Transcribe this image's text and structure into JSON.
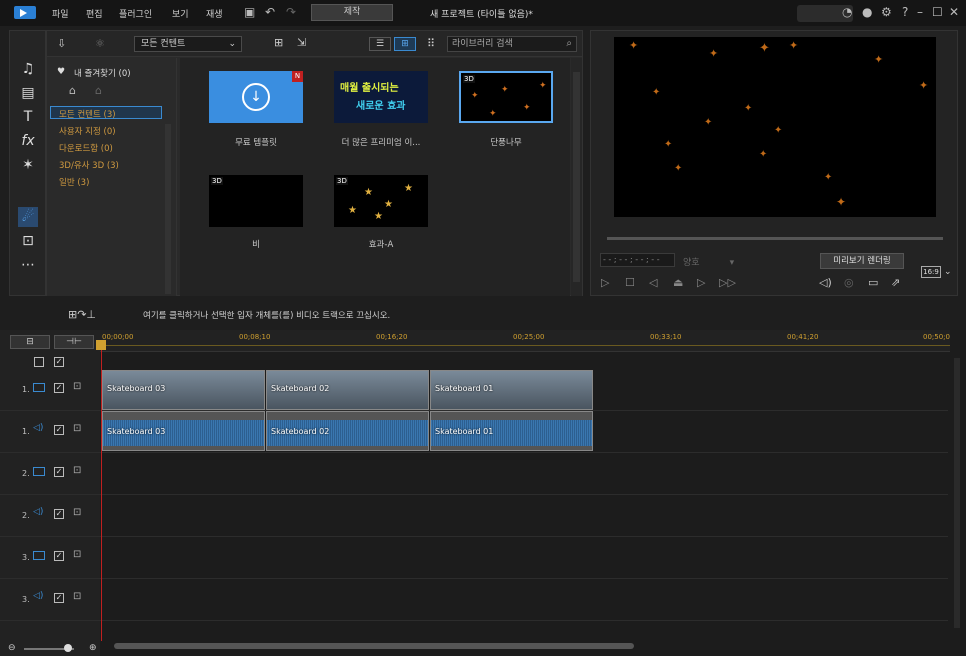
{
  "menu": {
    "file": "파일",
    "edit": "편집",
    "plugin": "플러그인",
    "view": "보기",
    "play": "재생",
    "produce": "제작",
    "title": "새 프로젝트 (타이틀 없음)*"
  },
  "library": {
    "content_filter": "모든 컨텐트",
    "search_placeholder": "라이브러리 검색",
    "tree": {
      "favorites": "내 즐겨찾기 (0)",
      "items": [
        "모든 컨텐트 (3)",
        "사용자 지정 (0)",
        "다운로드함 (0)",
        "3D/유사 3D (3)",
        "일반 (3)"
      ]
    },
    "thumbs": [
      {
        "label": "무료 템플릿",
        "tag": "N"
      },
      {
        "label": "더 많은 프리미엄 이...",
        "banner1": "매월 출시되는",
        "banner2": "새로운 효과"
      },
      {
        "label": "단풍나무",
        "tag": "3D"
      },
      {
        "label": "비",
        "tag": "3D"
      },
      {
        "label": "효과-A",
        "tag": "3D"
      }
    ]
  },
  "preview": {
    "timecode": "- - ; - - ; - - ; - -",
    "quality": "양호",
    "render_button": "미리보기 렌더링",
    "ratio": "16:9"
  },
  "timeline": {
    "hint": "여기를 클릭하거나 선택한 입자 개체를(를) 비디오 트랙으로 끄십시오.",
    "ticks": [
      "00;00;00",
      "00;08;10",
      "00;16;20",
      "00;25;00",
      "00;33;10",
      "00;41;20",
      "00;50;0"
    ],
    "tracks": [
      {
        "num": "1.",
        "type": "video"
      },
      {
        "num": "1.",
        "type": "audio"
      },
      {
        "num": "2.",
        "type": "video"
      },
      {
        "num": "2.",
        "type": "audio"
      },
      {
        "num": "3.",
        "type": "video"
      },
      {
        "num": "3.",
        "type": "audio"
      }
    ],
    "clips_video": [
      "Skateboard 03",
      "Skateboard 02",
      "Skateboard 01"
    ],
    "clips_audio": [
      "Skateboard 03",
      "Skateboard 02",
      "Skateboard 01"
    ]
  },
  "icons": [
    "app-logo-icon",
    "save-icon",
    "undo-icon",
    "redo-icon",
    "help-icon",
    "settings-icon",
    "minimize-icon",
    "maximize-icon",
    "close-icon"
  ]
}
